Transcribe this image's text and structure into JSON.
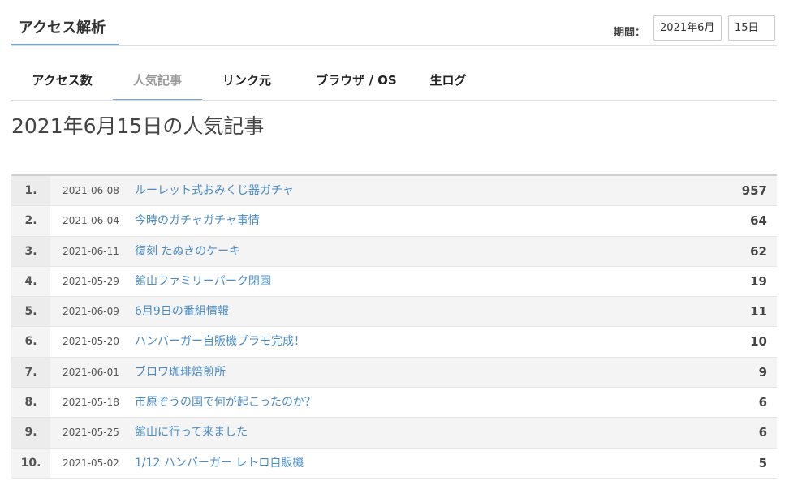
{
  "header": {
    "title": "アクセス解析",
    "period_label": "期間：",
    "period_month": "2021年6月",
    "period_day": "15日"
  },
  "tabs": [
    {
      "label": "アクセス数",
      "active": false
    },
    {
      "label": "人気記事",
      "active": true
    },
    {
      "label": "リンク元",
      "active": false
    },
    {
      "label": "ブラウザ / OS",
      "active": false
    },
    {
      "label": "生ログ",
      "active": false
    }
  ],
  "page_title": "2021年6月15日の人気記事",
  "rows": [
    {
      "rank": "1.",
      "date": "2021-06-08",
      "title": "ルーレット式おみくじ器ガチャ",
      "count": "957"
    },
    {
      "rank": "2.",
      "date": "2021-06-04",
      "title": "今時のガチャガチャ事情",
      "count": "64"
    },
    {
      "rank": "3.",
      "date": "2021-06-11",
      "title": "復刻 たぬきのケーキ",
      "count": "62"
    },
    {
      "rank": "4.",
      "date": "2021-05-29",
      "title": "館山ファミリーパーク閉園",
      "count": "19"
    },
    {
      "rank": "5.",
      "date": "2021-06-09",
      "title": "6月9日の番組情報",
      "count": "11"
    },
    {
      "rank": "6.",
      "date": "2021-05-20",
      "title": "ハンバーガー自販機プラモ完成！",
      "count": "10"
    },
    {
      "rank": "7.",
      "date": "2021-06-01",
      "title": "ブロワ珈琲焙煎所",
      "count": "9"
    },
    {
      "rank": "8.",
      "date": "2021-05-18",
      "title": "市原ぞうの国で何が起こったのか？",
      "count": "6"
    },
    {
      "rank": "9.",
      "date": "2021-05-25",
      "title": "館山に行って来ました",
      "count": "6"
    },
    {
      "rank": "10.",
      "date": "2021-05-02",
      "title": "1/12 ハンバーガー レトロ自販機",
      "count": "5"
    }
  ]
}
